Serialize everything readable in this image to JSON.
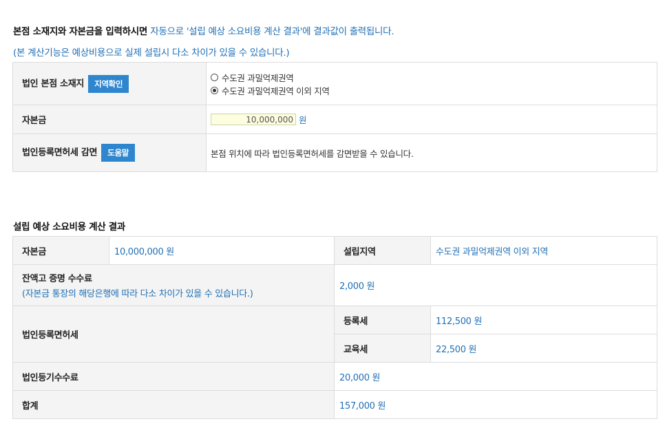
{
  "intro": {
    "bold_text": "본점 소재지와 자본금을 입력하시면 ",
    "highlight_text": "자동으로 '설립 예상 소요비용 계산 결과'",
    "tail_text": "에 결과값이 출력됩니다.",
    "note": "(본 계산기능은 예상비용으로 실제 설립시 다소 차이가 있을 수 있습니다.)"
  },
  "form": {
    "location_label": "법인 본점 소재지",
    "location_button": "지역확인",
    "location_options": [
      {
        "label": "수도권 과밀억제권역",
        "selected": false
      },
      {
        "label": "수도권 과밀억제권역 이외 지역",
        "selected": true
      }
    ],
    "capital_label": "자본금",
    "capital_value": "10,000,000",
    "capital_unit": "원",
    "tax_label": "법인등록면허세 감면",
    "help_button": "도움말",
    "tax_description": "본점 위치에 따라 법인등록면허세를 감면받을 수 있습니다."
  },
  "result": {
    "title": "설립 예상 소요비용 계산 결과",
    "capital_label": "자본금",
    "capital_value": "10,000,000 원",
    "region_label": "설립지역",
    "region_value": "수도권 과밀억제권역 이외 지역",
    "balance_label": "잔액고 증명 수수료",
    "balance_note": "(자본금 통장의 해당은행에 따라 다소 차이가 있을 수 있습니다.)",
    "balance_value": "2,000 원",
    "license_tax_label": "법인등록면허세",
    "registration_tax_label": "등록세",
    "registration_tax_value": "112,500 원",
    "education_tax_label": "교육세",
    "education_tax_value": "22,500 원",
    "registry_fee_label": "법인등기수수료",
    "registry_fee_value": "20,000 원",
    "total_label": "합계",
    "total_value": "157,000 원"
  },
  "colors": {
    "accent": "#1f6fb5",
    "button": "#2e86cf",
    "header_bg": "#f4f4f4",
    "input_bg": "#fdfde0"
  }
}
